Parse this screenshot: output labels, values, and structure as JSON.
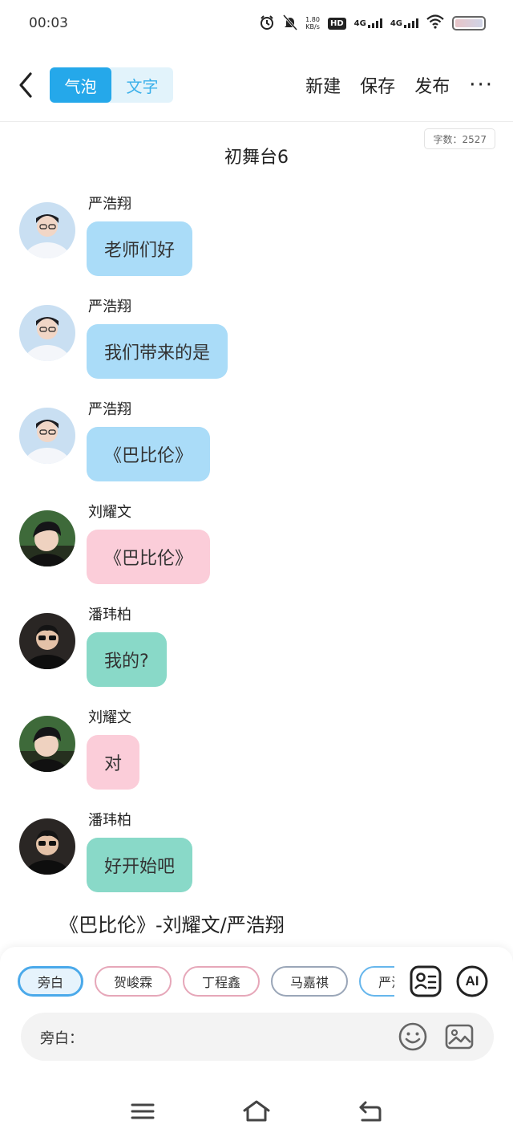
{
  "status": {
    "time": "00:03",
    "speed_value": "1.80",
    "speed_unit": "KB/s",
    "hd": "HD",
    "sim1": "4G",
    "sim2": "4G"
  },
  "toolbar": {
    "tab_bubble": "气泡",
    "tab_text": "文字",
    "new_label": "新建",
    "save_label": "保存",
    "publish_label": "发布",
    "more_label": "···"
  },
  "doc": {
    "word_count": "字数：2527",
    "title": "初舞台6"
  },
  "messages": [
    {
      "name": "严浩翔",
      "text": "老师们好",
      "color": "#aadcf8"
    },
    {
      "name": "严浩翔",
      "text": "我们带来的是",
      "color": "#aadcf8"
    },
    {
      "name": "严浩翔",
      "text": "《巴比伦》",
      "color": "#aadcf8"
    },
    {
      "name": "刘耀文",
      "text": "《巴比伦》",
      "color": "#fbcdd9"
    },
    {
      "name": "潘玮柏",
      "text": "我的?",
      "color": "#89d9c8"
    },
    {
      "name": "刘耀文",
      "text": "对",
      "color": "#fbcdd9"
    },
    {
      "name": "潘玮柏",
      "text": "好开始吧",
      "color": "#89d9c8"
    }
  ],
  "song_line": "《巴比伦》-刘耀文/严浩翔",
  "characters": [
    "旁白",
    "贺峻霖",
    "丁程鑫",
    "马嘉祺",
    "严浩"
  ],
  "input": {
    "label": "旁白：",
    "ai_label": "AI"
  },
  "colors": {
    "accent": "#25a8ea",
    "bubble_blue": "#aadcf8",
    "bubble_pink": "#fbcdd9",
    "bubble_green": "#89d9c8"
  }
}
